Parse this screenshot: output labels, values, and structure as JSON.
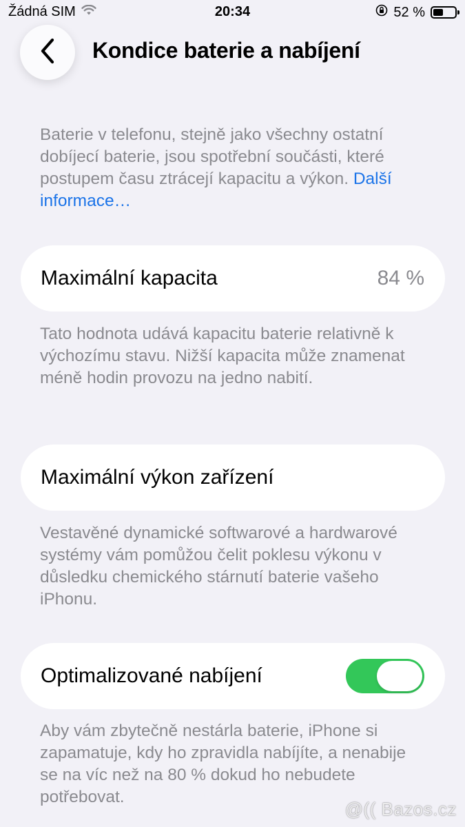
{
  "status_bar": {
    "carrier": "Žádná SIM",
    "time": "20:34",
    "battery_percent": "52 %",
    "battery_level": 0.52,
    "icons": [
      "wifi-icon",
      "orientation-lock-icon",
      "battery-icon"
    ]
  },
  "nav": {
    "back_icon": "chevron-left-icon",
    "title": "Kondice baterie a nabíjení"
  },
  "intro": {
    "text": "Baterie v telefonu, stejně jako všechny ostatní dobíjecí baterie, jsou spotřební součásti, které postupem času ztrácejí kapacitu a výkon. ",
    "link": "Další informace…"
  },
  "max_capacity": {
    "label": "Maximální kapacita",
    "value": "84 %",
    "description": "Tato hodnota udává kapacitu baterie relativně k výchozímu stavu. Nižší kapacita může znamenat méně hodin provozu na jedno nabití."
  },
  "peak_performance": {
    "label": "Maximální výkon zařízení",
    "description": "Vestavěné dynamické softwarové a hardwarové systémy vám pomůžou čelit poklesu výkonu v důsledku chemického stárnutí baterie vašeho iPhonu."
  },
  "optimized_charging": {
    "label": "Optimalizované nabíjení",
    "enabled": true,
    "description": "Aby vám zbytečně nestárla baterie, iPhone si zapamatuje, kdy ho zpravidla nabíjíte, a nenabije se na víc než na 80 % dokud ho nebudete potřebovat."
  },
  "watermark": "@(( Bazos.cz",
  "colors": {
    "background": "#f2f1f7",
    "link": "#1a73e8",
    "toggle_on": "#33c759",
    "secondary_text": "#8a8a8f"
  }
}
